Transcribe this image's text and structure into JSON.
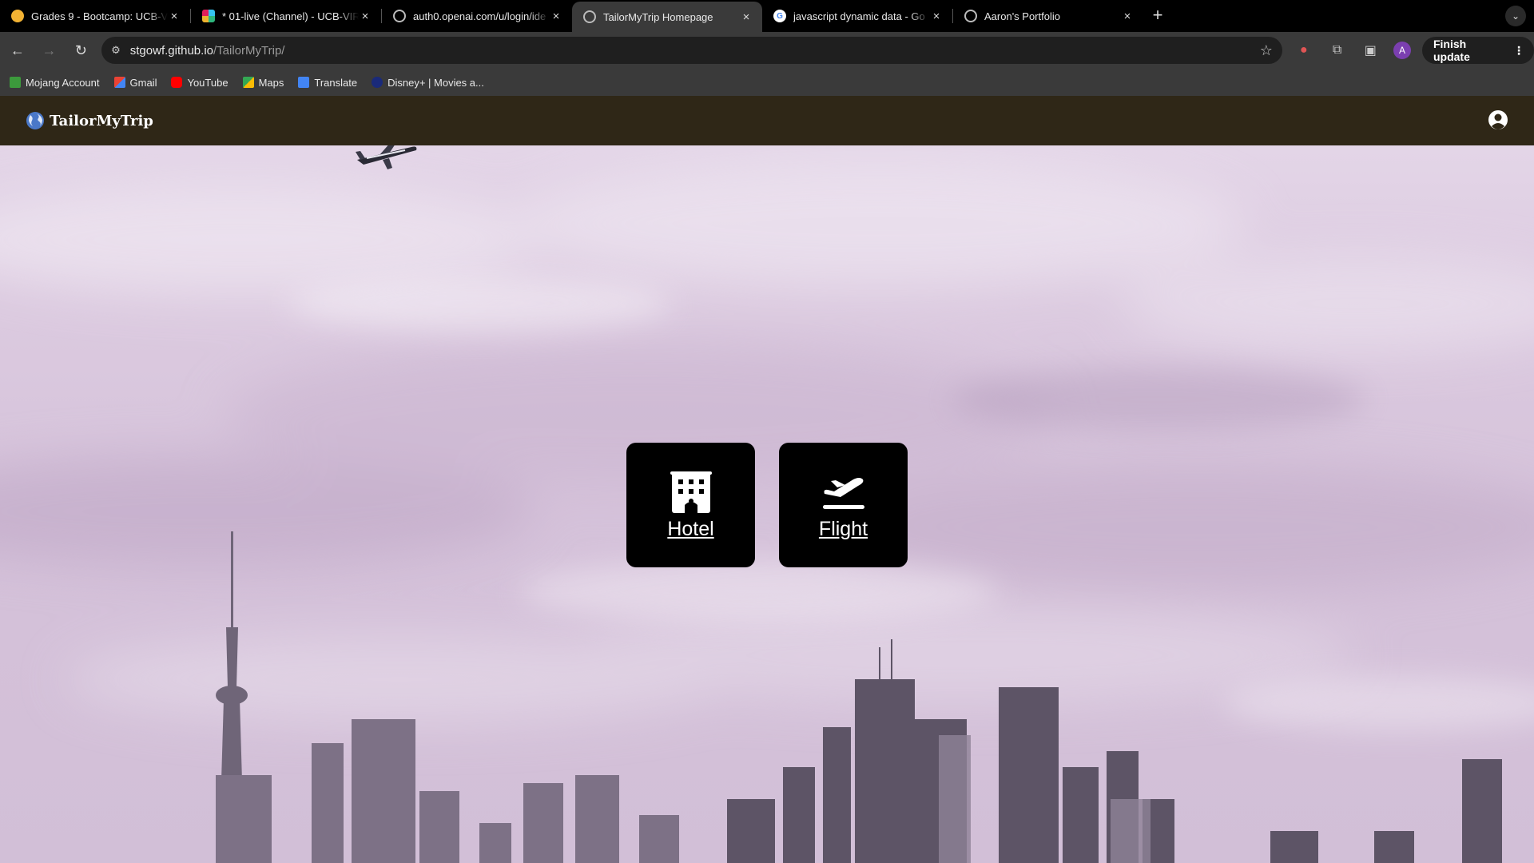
{
  "browser": {
    "tabs": [
      {
        "title": "Grades 9 - Bootcamp: UCB-V",
        "favicon_color": "#f2b233",
        "active": false
      },
      {
        "title": "* 01-live (Channel) - UCB-VIR",
        "favicon_color": "#e01e5a",
        "active": false
      },
      {
        "title": "auth0.openai.com/u/login/ide",
        "favicon_color": "#bbbbbb",
        "active": false
      },
      {
        "title": "TailorMyTrip Homepage",
        "favicon_color": "#bbbbbb",
        "active": true
      },
      {
        "title": "javascript dynamic data - Go",
        "favicon_color": "#4285f4",
        "active": false
      },
      {
        "title": "Aaron's Portfolio",
        "favicon_color": "#bbbbbb",
        "active": false
      }
    ],
    "close_glyph": "×",
    "new_tab_glyph": "+",
    "url_host": "stgowf.github.io",
    "url_path": "/TailorMyTrip/",
    "profile_initial": "A",
    "finish_update_label": "Finish update",
    "bookmarks": [
      {
        "label": "Mojang Account",
        "icon_color": "#3c9a3c"
      },
      {
        "label": "Gmail",
        "icon_color": "#ea4335"
      },
      {
        "label": "YouTube",
        "icon_color": "#ff0000"
      },
      {
        "label": "Maps",
        "icon_color": "#34a853"
      },
      {
        "label": "Translate",
        "icon_color": "#4285f4"
      },
      {
        "label": "Disney+ | Movies a...",
        "icon_color": "#1a2a7a"
      }
    ]
  },
  "site": {
    "brand": "TailorMyTrip",
    "header_color": "#2f2717",
    "cards": [
      {
        "label": "Hotel",
        "icon": "hotel-icon"
      },
      {
        "label": "Flight",
        "icon": "flight-icon"
      }
    ]
  }
}
